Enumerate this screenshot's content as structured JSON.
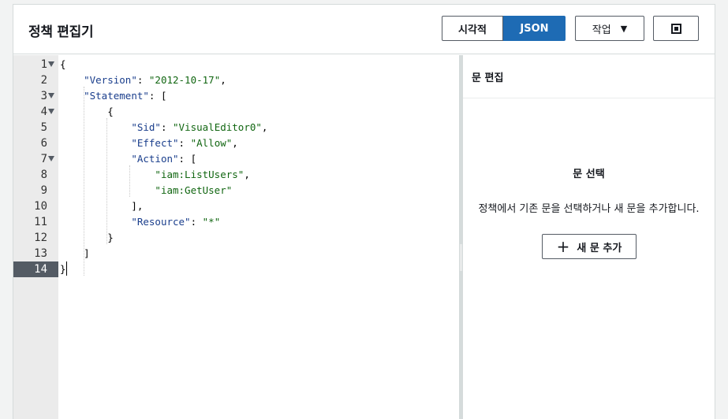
{
  "header": {
    "title": "정책 편집기",
    "tabs": [
      {
        "label": "시각적",
        "selected": false
      },
      {
        "label": "JSON",
        "selected": true
      }
    ],
    "actions_label": "작업",
    "actions_caret": "▼"
  },
  "editor": {
    "lines": [
      {
        "num": "1",
        "foldable": true
      },
      {
        "num": "2",
        "foldable": false
      },
      {
        "num": "3",
        "foldable": true
      },
      {
        "num": "4",
        "foldable": true
      },
      {
        "num": "5",
        "foldable": false
      },
      {
        "num": "6",
        "foldable": false
      },
      {
        "num": "7",
        "foldable": true
      },
      {
        "num": "8",
        "foldable": false
      },
      {
        "num": "9",
        "foldable": false
      },
      {
        "num": "10",
        "foldable": false
      },
      {
        "num": "11",
        "foldable": false
      },
      {
        "num": "12",
        "foldable": false
      },
      {
        "num": "13",
        "foldable": false
      },
      {
        "num": "14",
        "foldable": false,
        "active": true
      }
    ],
    "code": {
      "l1": "{",
      "version_key": "\"Version\"",
      "version_val": "\"2012-10-17\"",
      "statement_key": "\"Statement\"",
      "l4": "{",
      "sid_key": "\"Sid\"",
      "sid_val": "\"VisualEditor0\"",
      "effect_key": "\"Effect\"",
      "effect_val": "\"Allow\"",
      "action_key": "\"Action\"",
      "action_1": "\"iam:ListUsers\"",
      "action_2": "\"iam:GetUser\"",
      "l10": "],",
      "resource_key": "\"Resource\"",
      "resource_val": "\"*\"",
      "l12": "}",
      "l13": "]",
      "l14": "}"
    }
  },
  "side_panel": {
    "title": "문 편집",
    "empty_title": "문 선택",
    "empty_description": "정책에서 기존 문을 선택하거나 새 문을 추가합니다.",
    "add_button_label": "새 문 추가",
    "add_button_icon": "plus-icon"
  }
}
